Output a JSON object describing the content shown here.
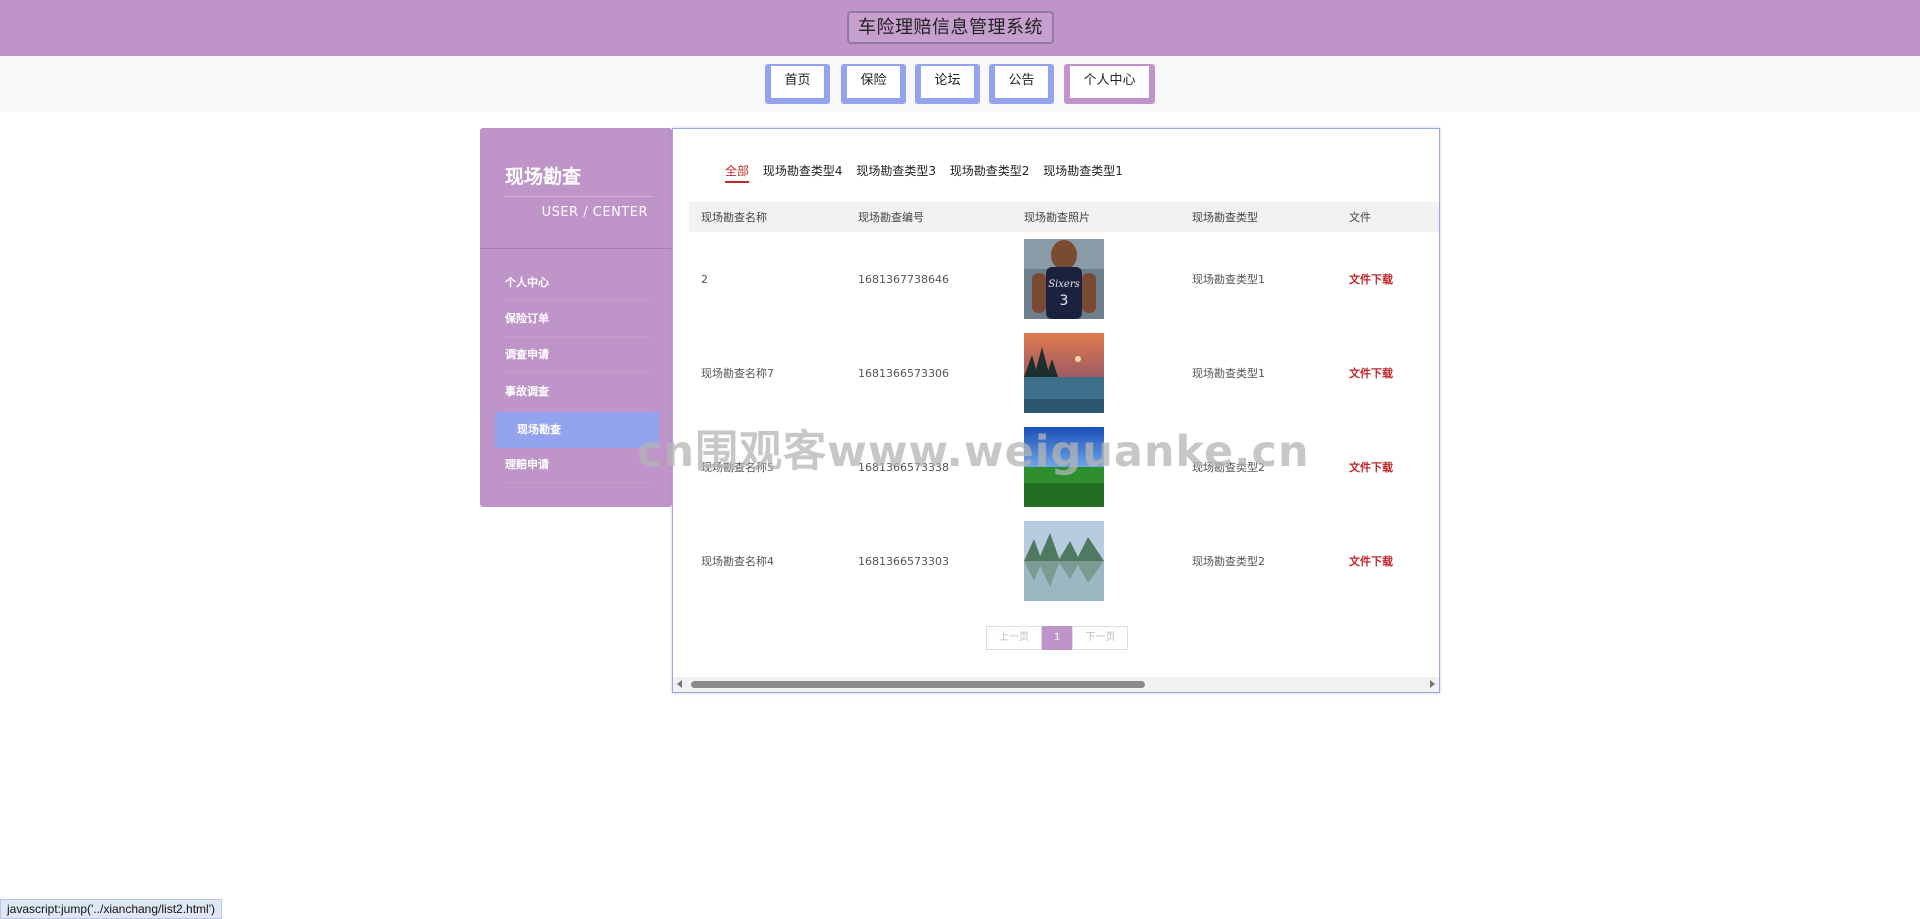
{
  "header": {
    "title": "车险理赔信息管理系统"
  },
  "nav": [
    "首页",
    "保险",
    "论坛",
    "公告",
    "个人中心"
  ],
  "sidebar": {
    "title": "现场勘查",
    "subtitle": "USER / CENTER",
    "items": [
      "个人中心",
      "保险订单",
      "调查申请",
      "事故调查",
      "现场勘查",
      "理赔申请"
    ]
  },
  "filters": [
    "全部",
    "现场勘查类型4",
    "现场勘查类型3",
    "现场勘查类型2",
    "现场勘查类型1"
  ],
  "table": {
    "headers": [
      "现场勘查名称",
      "现场勘查编号",
      "现场勘查照片",
      "现场勘查类型",
      "文件"
    ],
    "rows": [
      {
        "name": "2",
        "code": "1681367738646",
        "type": "现场勘查类型1",
        "file": "文件下载",
        "photo": "basketball-player-image"
      },
      {
        "name": "现场勘查名称7",
        "code": "1681366573306",
        "type": "现场勘查类型1",
        "file": "文件下载",
        "photo": "sunset-lake-image"
      },
      {
        "name": "现场勘查名称5",
        "code": "1681366573338",
        "type": "现场勘查类型2",
        "file": "文件下载",
        "photo": "green-field-image"
      },
      {
        "name": "现场勘查名称4",
        "code": "1681366573303",
        "type": "现场勘查类型2",
        "file": "文件下载",
        "photo": "mountain-lake-image"
      }
    ]
  },
  "pager": {
    "prev": "上一页",
    "current": "1",
    "next": "下一页"
  },
  "watermark": "cn围观客www.weiguanke.cn",
  "statusbar": "javascript:jump('../xianchang/list2.html')",
  "colors": {
    "header": "#bf94c9",
    "nav_border": "#94a3ee",
    "accent_red": "#c0282b",
    "sidebar_active": "#94a3ee"
  }
}
